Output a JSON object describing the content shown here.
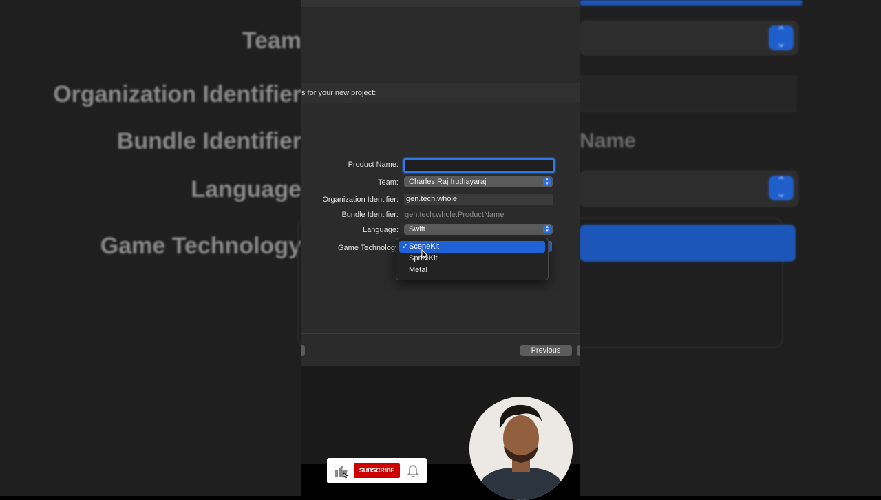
{
  "background_zoom": {
    "labels": [
      "Team",
      "Organization Identifier",
      "Bundle Identifier",
      "Language",
      "Game Technology"
    ],
    "product_name_hint": "Name"
  },
  "sheet": {
    "header": "s for your new project:",
    "fields": {
      "product_name": {
        "label": "Product Name:",
        "value": ""
      },
      "team": {
        "label": "Team:",
        "value": "Charles Raj Iruthayaraj"
      },
      "organization_identifier": {
        "label": "Organization Identifier:",
        "value": "gen.tech.whole"
      },
      "bundle_identifier": {
        "label": "Bundle Identifier:",
        "value": "gen.tech.whole.ProductName"
      },
      "language": {
        "label": "Language:",
        "value": "Swift"
      },
      "game_technology": {
        "label": "Game Technology"
      }
    },
    "menu": {
      "check_mark": "✓",
      "options": [
        "SceneKit",
        "SpriteKit",
        "Metal"
      ],
      "selected": "SceneKit"
    },
    "buttons": {
      "previous": "Previous"
    }
  },
  "overlay": {
    "subscribe_label": "SUBSCRIBE"
  },
  "colors": {
    "accent_blue": "#1f62d6",
    "subscribe_red": "#cc0000"
  }
}
